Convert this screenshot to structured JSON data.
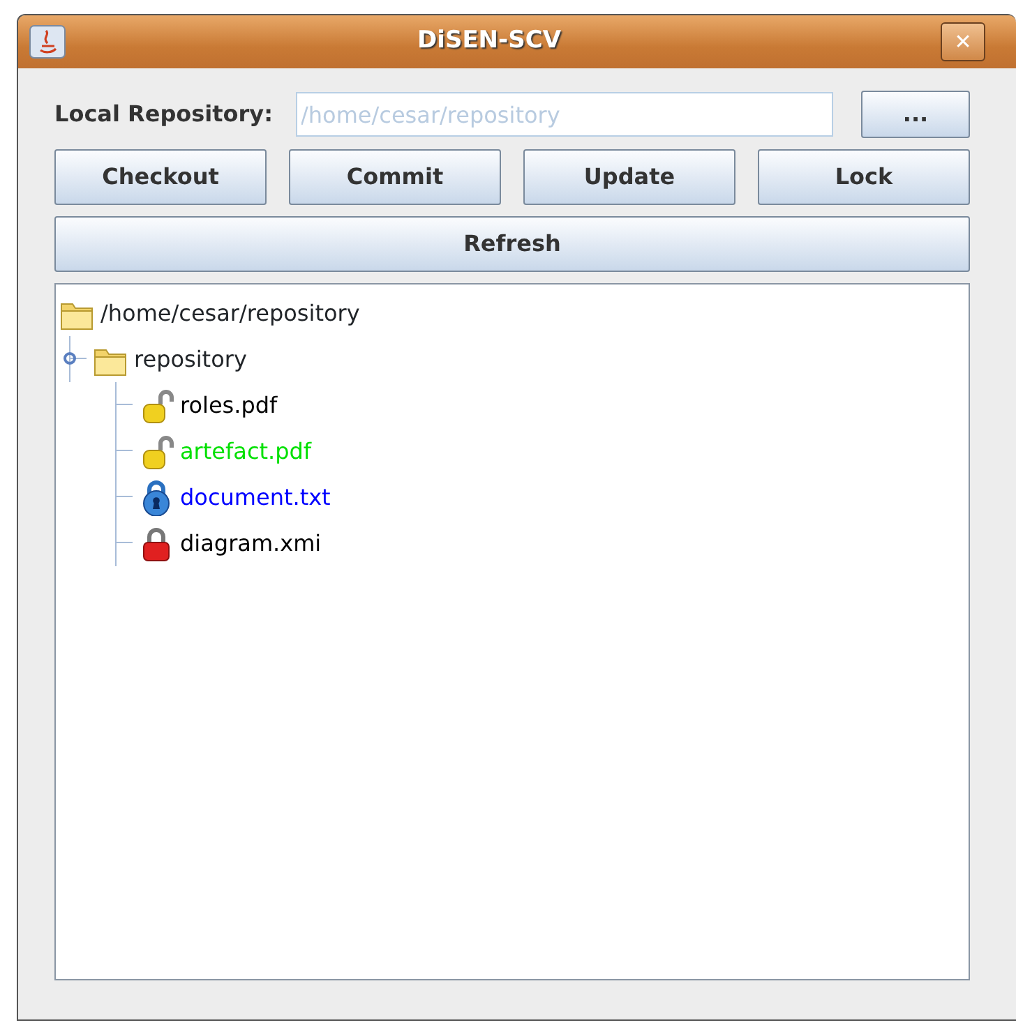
{
  "window": {
    "title": "DiSEN-SCV",
    "close": "✕"
  },
  "repository": {
    "label": "Local Repository:",
    "value": "/home/cesar/repository",
    "disabled": true,
    "browse": "..."
  },
  "actions": [
    "Checkout",
    "Commit",
    "Update",
    "Lock"
  ],
  "refresh": "Refresh",
  "tree": {
    "label": "/home/cesar/repository",
    "kind": "folder",
    "expanded": true,
    "children": [
      {
        "label": "repository",
        "kind": "folder",
        "expanded": true,
        "children": [
          {
            "label": "roles.pdf",
            "kind": "unlocked",
            "color": "#000000"
          },
          {
            "label": "artefact.pdf",
            "kind": "unlocked",
            "color": "#00e000"
          },
          {
            "label": "document.txt",
            "kind": "locked-mine",
            "color": "#0000ff"
          },
          {
            "label": "diagram.xmi",
            "kind": "locked-other",
            "color": "#000000"
          }
        ]
      }
    ]
  }
}
